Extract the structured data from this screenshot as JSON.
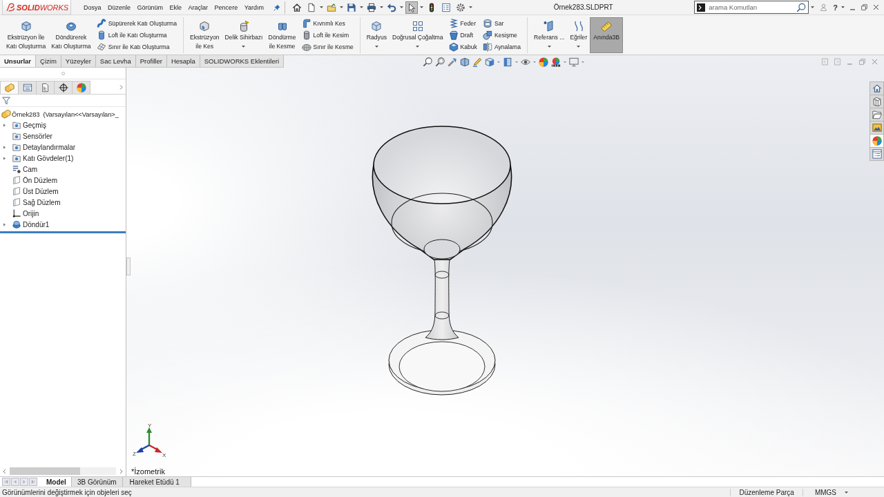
{
  "app": {
    "logo": "**SOLID**WORKS",
    "menu": [
      "Dosya",
      "Düzenle",
      "Görünüm",
      "Ekle",
      "Araçlar",
      "Pencere",
      "Yardım"
    ],
    "quick_access": [
      {
        "kind": "home",
        "dropdown": false,
        "pressed": false
      },
      {
        "kind": "new",
        "dropdown": true,
        "pressed": false
      },
      {
        "kind": "open",
        "dropdown": true,
        "pressed": false
      },
      {
        "kind": "save",
        "dropdown": true,
        "pressed": false
      },
      {
        "kind": "print",
        "dropdown": true,
        "pressed": false
      },
      {
        "kind": "undo",
        "dropdown": true,
        "pressed": false
      },
      {
        "kind": "select",
        "dropdown": true,
        "pressed": true
      },
      {
        "kind": "rebuild",
        "dropdown": false,
        "pressed": false
      },
      {
        "kind": "properties",
        "dropdown": false,
        "pressed": false
      },
      {
        "kind": "options",
        "dropdown": true,
        "pressed": false
      }
    ],
    "document_title": "Örnek283.SLDPRT",
    "search": {
      "placeholder": "arama Komutları"
    },
    "help": "?"
  },
  "ribbon": {
    "groups": [
      {
        "buttons": [
          {
            "label": "Ekstrüzyon İle\nKatı Oluşturma",
            "dropdown": false,
            "on": false
          },
          {
            "label": "Döndürerek\nKatı Oluşturma",
            "dropdown": false,
            "on": false
          }
        ],
        "stacks": [
          [
            "Süpürerek Katı Oluşturma",
            "Loft ile Katı Oluşturma",
            "Sınır ile Katı Oluşturma"
          ]
        ]
      },
      {
        "buttons": [
          {
            "label": "Ekstrüzyon\nile Kes",
            "dropdown": false,
            "on": false
          },
          {
            "label": "Delik Sihirbazı",
            "dropdown": true,
            "on": false
          },
          {
            "label": "Döndürme\nile Kesme",
            "dropdown": false,
            "on": false
          }
        ],
        "stacks": [
          [
            "Kıvrımlı Kes",
            "Loft ile Kesim",
            "Sınır ile Kesme"
          ]
        ]
      },
      {
        "buttons": [
          {
            "label": "Radyus",
            "dropdown": true,
            "on": false
          },
          {
            "label": "Doğrusal Çoğaltma",
            "dropdown": true,
            "on": false
          }
        ],
        "stacks": [
          [
            "Feder",
            "Draft",
            "Kabuk"
          ],
          [
            "Sar",
            "Kesişme",
            "Aynalama"
          ]
        ]
      },
      {
        "buttons": [
          {
            "label": "Referans ...",
            "dropdown": true,
            "on": false
          },
          {
            "label": "Eğriler",
            "dropdown": true,
            "on": false
          },
          {
            "label": "Anında3B",
            "dropdown": false,
            "on": true
          }
        ]
      }
    ]
  },
  "command_tabs": [
    {
      "label": "Unsurlar",
      "selected": true
    },
    {
      "label": "Çizim",
      "selected": false
    },
    {
      "label": "Yüzeyler",
      "selected": false
    },
    {
      "label": "Sac Levha",
      "selected": false
    },
    {
      "label": "Profiller",
      "selected": false
    },
    {
      "label": "Hesapla",
      "selected": false
    },
    {
      "label": "SOLIDWORKS Eklentileri",
      "selected": false
    }
  ],
  "feature_tree": {
    "tabs": [
      {
        "selected": true
      },
      {
        "selected": false
      },
      {
        "selected": false
      },
      {
        "selected": false
      },
      {
        "selected": false
      }
    ],
    "root": {
      "label": "Örnek283  (Varsayılan<<Varsayılan>_",
      "children": [
        {
          "label": "Geçmiş",
          "kind": "folder",
          "expandable": true
        },
        {
          "label": "Sensörler",
          "kind": "folder",
          "expandable": false
        },
        {
          "label": "Detaylandırmalar",
          "kind": "folder",
          "expandable": true
        },
        {
          "label": "Katı Gövdeler(1)",
          "kind": "folder",
          "expandable": true
        },
        {
          "label": "Cam",
          "kind": "material",
          "expandable": false
        },
        {
          "label": "Ön Düzlem",
          "kind": "plane",
          "expandable": false
        },
        {
          "label": "Üst Düzlem",
          "kind": "plane",
          "expandable": false
        },
        {
          "label": "Sağ Düzlem",
          "kind": "plane",
          "expandable": false
        },
        {
          "label": "Orijin",
          "kind": "origin",
          "expandable": false
        },
        {
          "label": "Döndür1",
          "kind": "feature",
          "expandable": true
        }
      ]
    }
  },
  "viewport": {
    "view_label": "*İzometrik",
    "triad": {
      "x": "X",
      "y": "Y",
      "z": "Z"
    },
    "task_pane": [
      {
        "selected": false
      },
      {
        "selected": false
      },
      {
        "selected": false
      },
      {
        "selected": false
      },
      {
        "selected": true
      },
      {
        "selected": false
      }
    ]
  },
  "bottom_tabs": [
    {
      "label": "Model",
      "selected": true
    },
    {
      "label": "3B Görünüm",
      "selected": false
    },
    {
      "label": "Hareket Etüdü 1",
      "selected": false
    }
  ],
  "status_bar": {
    "message": "Görünümlerini değiştirmek için objeleri seç",
    "mode": "Düzenleme Parça",
    "units": "MMGS"
  }
}
